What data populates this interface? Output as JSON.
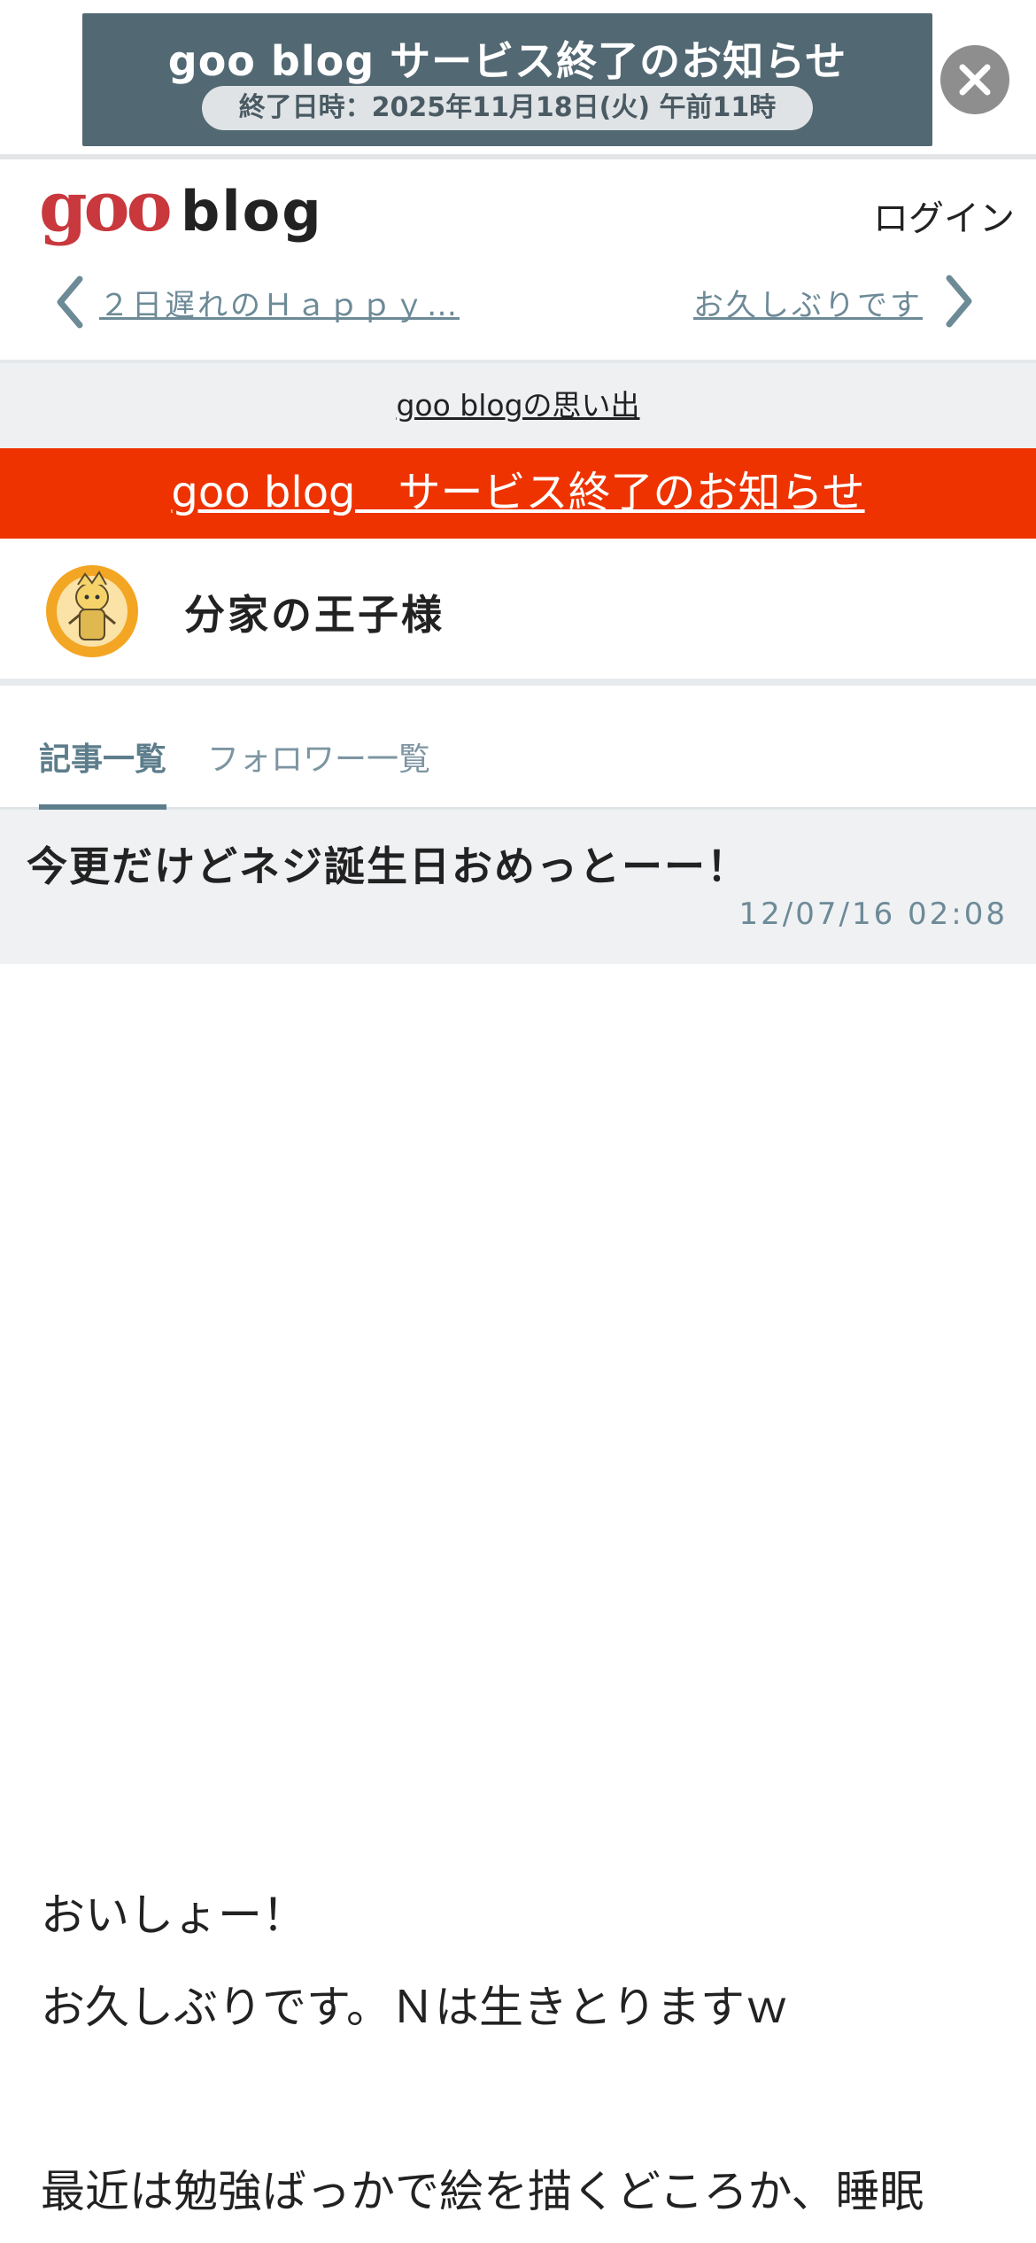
{
  "notice_banner": {
    "title": "goo blog サービス終了のお知らせ",
    "subtitle": "終了日時：2025年11月18日(火) 午前11時",
    "close_icon": "close-icon",
    "bg_color": "#526873"
  },
  "header": {
    "logo_goo": "goo",
    "logo_blog": "blog",
    "login_label": "ログイン",
    "prev_article": "２日遅れのＨａｐｐｙ…",
    "next_article": "お久しぶりです",
    "brand_color": "#c8383d"
  },
  "memories_link": "goo blogの思い出",
  "end_notice": {
    "label": "goo blog　サービス終了のお知らせ",
    "bg_color": "#ee3300"
  },
  "blog": {
    "name": "分家の王子様",
    "avatar_icon": "avatar"
  },
  "tabs": [
    {
      "label": "記事一覧",
      "active": true
    },
    {
      "label": "フォロワー一覧",
      "active": false
    }
  ],
  "article": {
    "title": "今更だけどネジ誕生日おめっとーー！",
    "date": "12/07/16 02:08",
    "body_lines": [
      "おいしょー！",
      "お久しぶりです。Ｎは生きとりますｗ",
      "",
      "最近は勉強ばっかで絵を描くどころか、睡眠"
    ]
  }
}
